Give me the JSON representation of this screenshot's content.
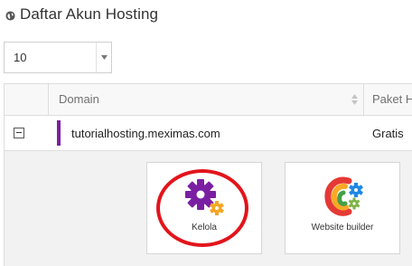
{
  "header": {
    "title": "Daftar Akun Hosting",
    "icon": "globe-icon"
  },
  "length_select": {
    "value": "10"
  },
  "table": {
    "columns": [
      "",
      "Domain",
      "Paket H"
    ],
    "rows": [
      {
        "domain": "tutorialhosting.meximas.com",
        "paket": "Gratis",
        "accent": "#7b1fa2"
      }
    ]
  },
  "detail": {
    "tiles": [
      {
        "label": "Kelola",
        "icon": "gear-icon"
      },
      {
        "label": "Website builder",
        "icon": "website-builder-icon"
      }
    ]
  },
  "colors": {
    "accent": "#7b1fa2",
    "annotation": "#e3141b",
    "gear_small": "#f5a623"
  }
}
